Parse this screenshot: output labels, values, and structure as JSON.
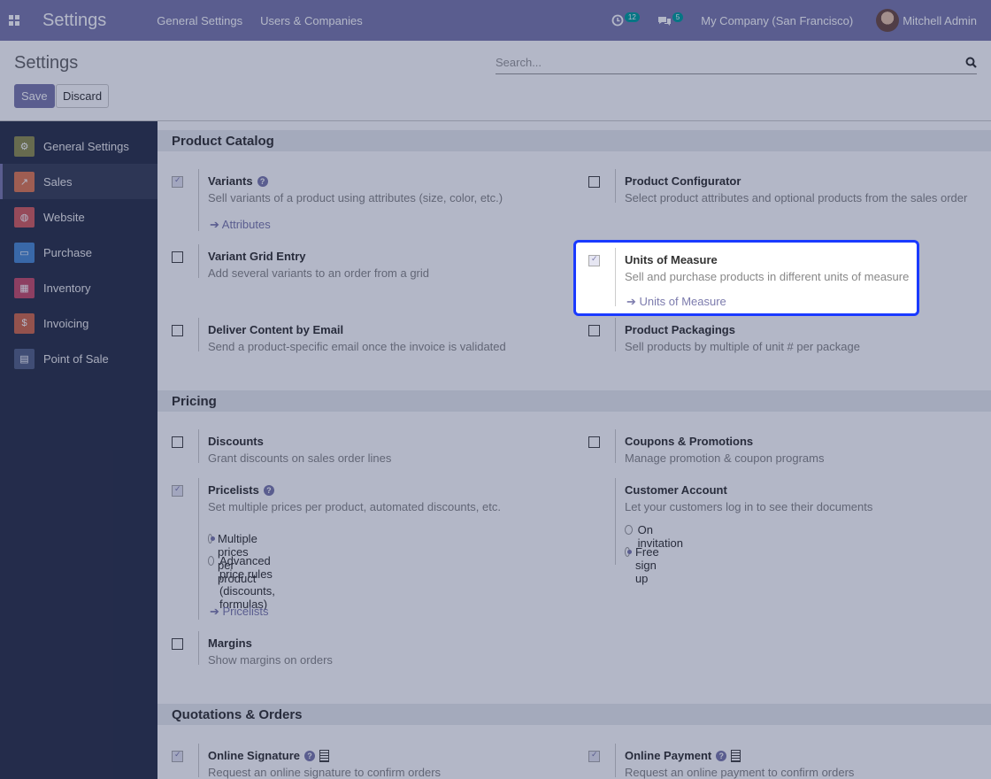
{
  "topbar": {
    "brand": "Settings",
    "menu": [
      "General Settings",
      "Users & Companies"
    ],
    "activity_count": "12",
    "message_count": "5",
    "company": "My Company (San Francisco)",
    "user": "Mitchell Admin"
  },
  "control_panel": {
    "title": "Settings",
    "search_placeholder": "Search...",
    "save_label": "Save",
    "discard_label": "Discard"
  },
  "sidebar": {
    "items": [
      {
        "label": "General Settings",
        "color": "#8f8f4f",
        "icon": "gear-icon",
        "glyph": "⚙"
      },
      {
        "label": "Sales",
        "color": "#e07b53",
        "icon": "sales-chart-icon",
        "glyph": "↗"
      },
      {
        "label": "Website",
        "color": "#d45f5f",
        "icon": "globe-icon",
        "glyph": "◍"
      },
      {
        "label": "Purchase",
        "color": "#4c8bd1",
        "icon": "card-icon",
        "glyph": "▭"
      },
      {
        "label": "Inventory",
        "color": "#c74f6a",
        "icon": "box-icon",
        "glyph": "▦"
      },
      {
        "label": "Invoicing",
        "color": "#d06a4c",
        "icon": "invoice-icon",
        "glyph": "$"
      },
      {
        "label": "Point of Sale",
        "color": "#566487",
        "icon": "store-icon",
        "glyph": "▤"
      }
    ]
  },
  "sections": {
    "catalog": "Product Catalog",
    "pricing": "Pricing",
    "quotations": "Quotations & Orders"
  },
  "catalog": {
    "variants": {
      "title": "Variants",
      "desc": "Sell variants of a product using attributes (size, color, etc.)",
      "link": "Attributes"
    },
    "configurator": {
      "title": "Product Configurator",
      "desc": "Select product attributes and optional products from the sales order"
    },
    "grid": {
      "title": "Variant Grid Entry",
      "desc": "Add several variants to an order from a grid"
    },
    "uom": {
      "title": "Units of Measure",
      "desc": "Sell and purchase products in different units of measure",
      "link": "Units of Measure"
    },
    "email": {
      "title": "Deliver Content by Email",
      "desc": "Send a product-specific email once the invoice is validated"
    },
    "packagings": {
      "title": "Product Packagings",
      "desc": "Sell products by multiple of unit # per package"
    }
  },
  "pricing": {
    "discounts": {
      "title": "Discounts",
      "desc": "Grant discounts on sales order lines"
    },
    "coupons": {
      "title": "Coupons & Promotions",
      "desc": "Manage promotion & coupon programs"
    },
    "pricelists": {
      "title": "Pricelists",
      "desc": "Set multiple prices per product, automated discounts, etc.",
      "opt1": "Multiple prices per product",
      "opt2a": "Advanced price rules",
      "opt2b": "(discounts, formulas)",
      "link": "Pricelists"
    },
    "account": {
      "title": "Customer Account",
      "desc": "Let your customers log in to see their documents",
      "opt1": "On invitation",
      "opt2": "Free sign up"
    },
    "margins": {
      "title": "Margins",
      "desc": "Show margins on orders"
    }
  },
  "quotations": {
    "signature": {
      "title": "Online Signature",
      "desc": "Request an online signature to confirm orders"
    },
    "payment": {
      "title": "Online Payment",
      "desc": "Request an online payment to confirm orders"
    }
  }
}
